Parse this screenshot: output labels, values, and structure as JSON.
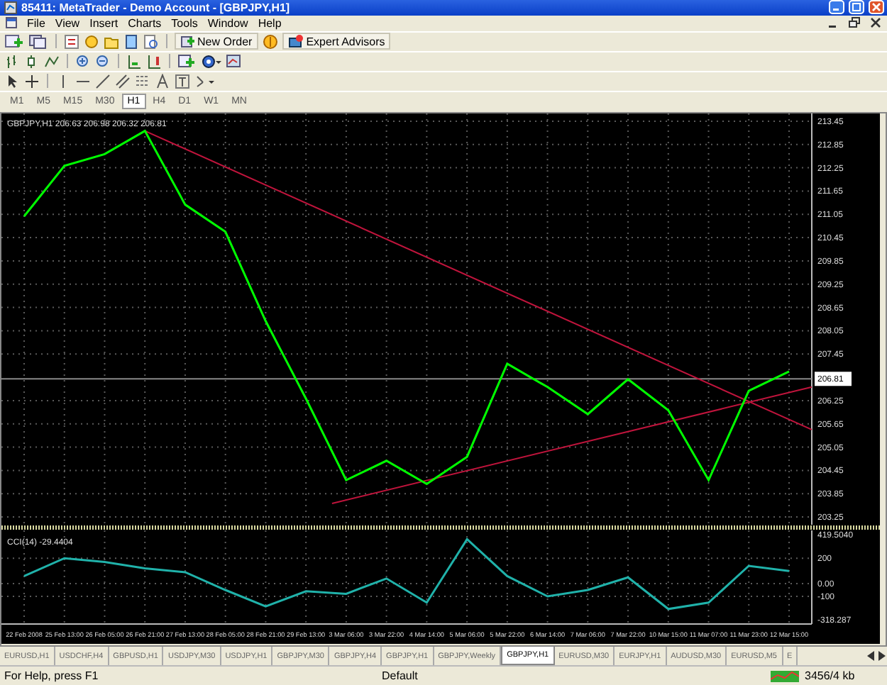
{
  "window": {
    "title": "85411: MetaTrader - Demo Account - [GBPJPY,H1]"
  },
  "menu": [
    "File",
    "View",
    "Insert",
    "Charts",
    "Tools",
    "Window",
    "Help"
  ],
  "toolbar": {
    "buttons": [
      "New Order",
      "Expert Advisors"
    ]
  },
  "timeframes": [
    {
      "label": "M1",
      "selected": false
    },
    {
      "label": "M5",
      "selected": false
    },
    {
      "label": "M15",
      "selected": false
    },
    {
      "label": "M30",
      "selected": false
    },
    {
      "label": "H1",
      "selected": true
    },
    {
      "label": "H4",
      "selected": false
    },
    {
      "label": "D1",
      "selected": false
    },
    {
      "label": "W1",
      "selected": false
    },
    {
      "label": "MN",
      "selected": false
    }
  ],
  "chart": {
    "quote": "206.63 206.98 206.32 206.81",
    "chart_data": {
      "type": "line",
      "grid": true,
      "ref_lines": [
        {
          "axis": "y",
          "value": 206.81,
          "label": "206.81"
        }
      ],
      "series": [
        {
          "name": "GBPJPY,H1",
          "color": "#00ff00",
          "values": [
            211.0,
            212.3,
            212.6,
            213.2,
            211.3,
            210.6,
            208.3,
            206.3,
            204.2,
            204.7,
            204.1,
            204.8,
            207.2,
            206.6,
            205.9,
            206.8,
            206.0,
            204.2,
            206.5,
            207.0
          ]
        }
      ],
      "ylim": [
        203.05,
        213.65
      ],
      "yticks": [
        {
          "value": 213.45,
          "label": "213.45"
        },
        {
          "value": 212.85,
          "label": "212.85"
        },
        {
          "value": 212.25,
          "label": "212.25"
        },
        {
          "value": 211.65,
          "label": "211.65"
        },
        {
          "value": 211.05,
          "label": "211.05"
        },
        {
          "value": 210.45,
          "label": "210.45"
        },
        {
          "value": 209.85,
          "label": "209.85"
        },
        {
          "value": 209.25,
          "label": "209.25"
        },
        {
          "value": 208.65,
          "label": "208.65"
        },
        {
          "value": 208.05,
          "label": "208.05"
        },
        {
          "value": 207.45,
          "label": "207.45"
        },
        {
          "value": 206.25,
          "label": "206.25"
        },
        {
          "value": 205.65,
          "label": "205.65"
        },
        {
          "value": 205.05,
          "label": "205.05"
        },
        {
          "value": 204.45,
          "label": "204.45"
        },
        {
          "value": 203.85,
          "label": "203.85"
        },
        {
          "value": 203.25,
          "label": "203.25"
        }
      ]
    }
  },
  "indicator": {
    "reading": "-29.4404",
    "chart_data": {
      "type": "line",
      "grid": true,
      "categories": [
        "22 Feb 2008",
        "25 Feb 13:00",
        "26 Feb 05:00",
        "26 Feb 21:00",
        "27 Feb 13:00",
        "28 Feb 05:00",
        "28 Feb 21:00",
        "29 Feb 13:00",
        "3 Mar 06:00",
        "3 Mar 22:00",
        "4 Mar 14:00",
        "5 Mar 06:00",
        "5 Mar 22:00",
        "6 Mar 14:00",
        "7 Mar 06:00",
        "7 Mar 22:00",
        "10 Mar 15:00",
        "11 Mar 07:00",
        "11 Mar 23:00",
        "12 Mar 15:00"
      ],
      "series": [
        {
          "name": "CCI(14)",
          "color": "#20b2aa",
          "values": [
            60,
            200,
            170,
            120,
            90,
            -50,
            -180,
            -60,
            -80,
            40,
            -150,
            350,
            60,
            -100,
            -50,
            50,
            -200,
            -150,
            140,
            100
          ]
        }
      ],
      "ylim": [
        -318.287,
        419.504
      ],
      "yticks": [
        {
          "value": 419.504,
          "label": "419.5040"
        },
        {
          "value": 200,
          "label": "200"
        },
        {
          "value": 0,
          "label": "0.00"
        },
        {
          "value": -100,
          "label": "-100"
        },
        {
          "value": -318.287,
          "label": "-318.287"
        }
      ]
    }
  },
  "tabs": [
    {
      "label": "EURUSD,H1",
      "selected": false
    },
    {
      "label": "USDCHF,H4",
      "selected": false
    },
    {
      "label": "GBPUSD,H1",
      "selected": false
    },
    {
      "label": "USDJPY,M30",
      "selected": false
    },
    {
      "label": "USDJPY,H1",
      "selected": false
    },
    {
      "label": "GBPJPY,M30",
      "selected": false
    },
    {
      "label": "GBPJPY,H4",
      "selected": false
    },
    {
      "label": "GBPJPY,H1",
      "selected": false
    },
    {
      "label": "GBPJPY,Weekly",
      "selected": false
    },
    {
      "label": "GBPJPY,H1",
      "selected": true
    },
    {
      "label": "EURUSD,M30",
      "selected": false
    },
    {
      "label": "EURJPY,H1",
      "selected": false
    },
    {
      "label": "AUDUSD,M30",
      "selected": false
    },
    {
      "label": "EURUSD,M5",
      "selected": false
    },
    {
      "label": "E",
      "selected": false
    }
  ],
  "status_bar": [
    "For Help, press F1",
    "Default",
    "3456/4 kb"
  ]
}
